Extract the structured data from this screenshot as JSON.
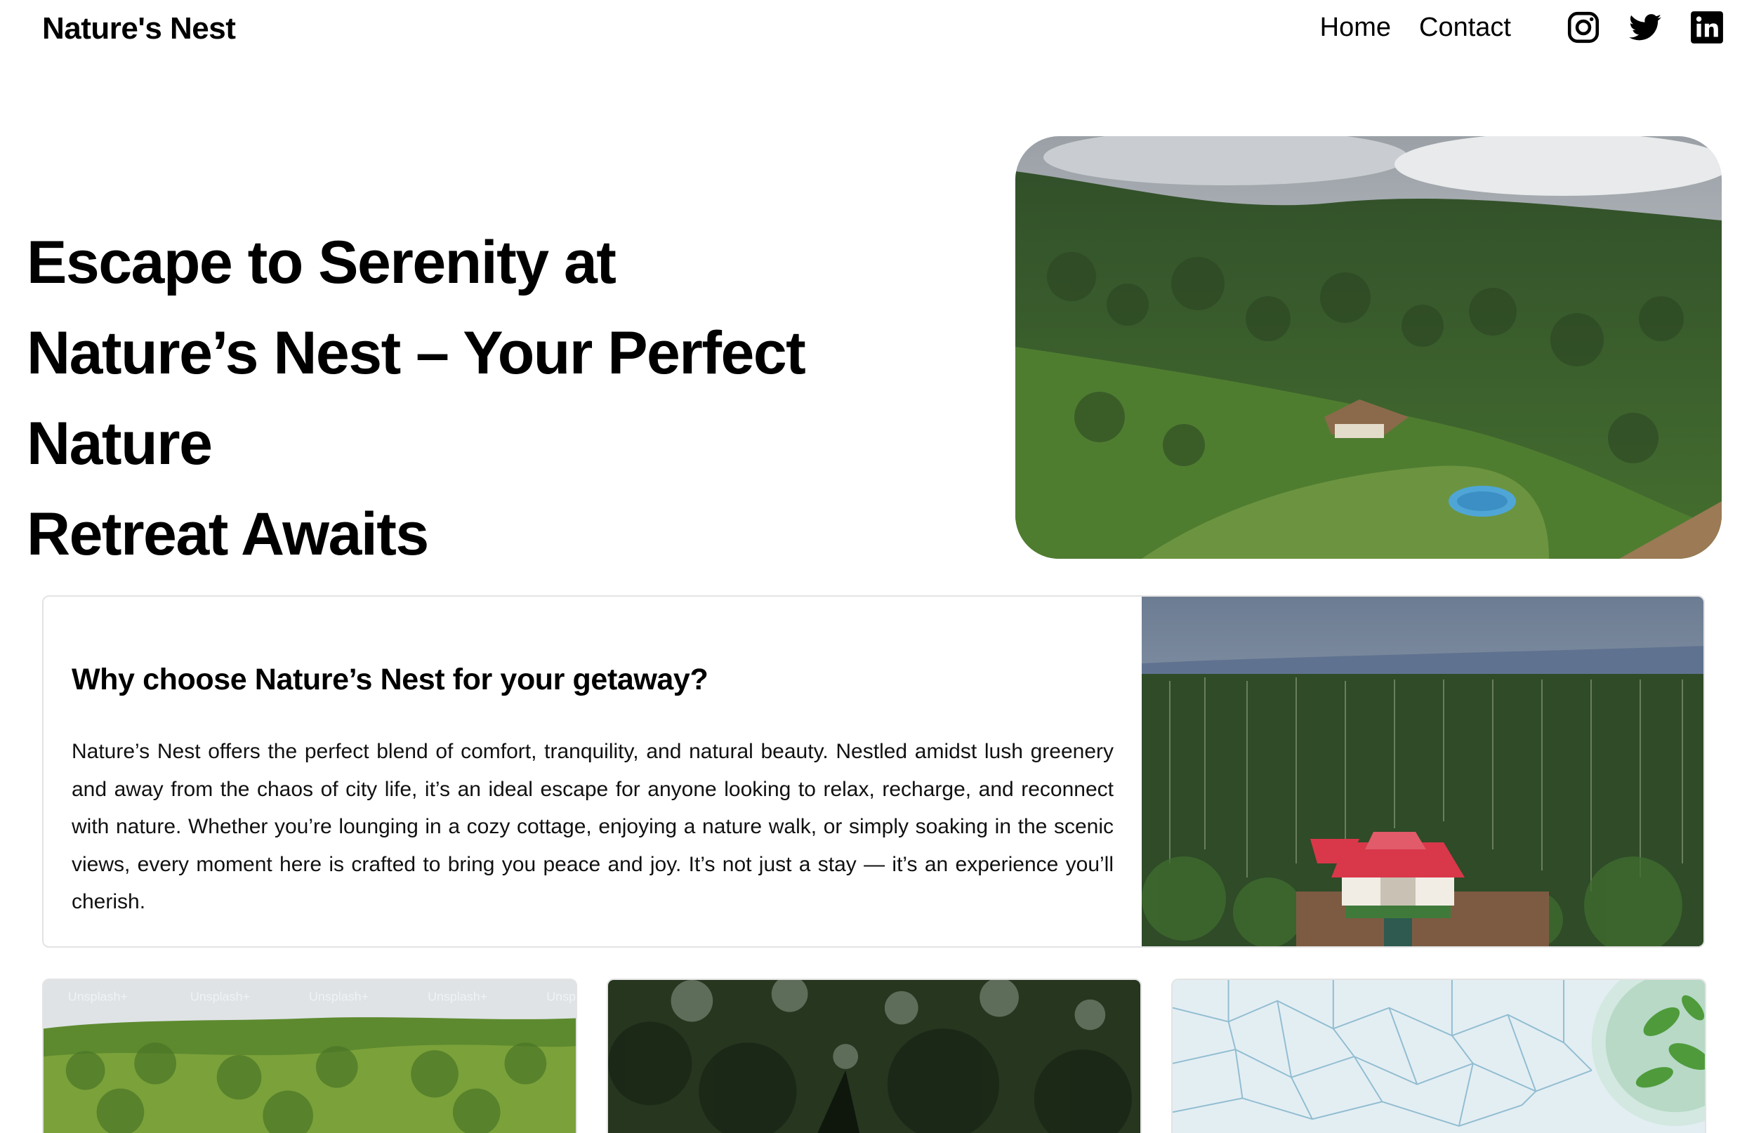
{
  "header": {
    "brand": "Nature's Nest",
    "nav": [
      {
        "label": "Home"
      },
      {
        "label": "Contact"
      }
    ],
    "social": [
      {
        "icon": "instagram-icon"
      },
      {
        "icon": "twitter-icon"
      },
      {
        "icon": "linkedin-icon"
      }
    ]
  },
  "hero": {
    "title_lines": [
      "Escape to Serenity at",
      "Nature’s Nest – Your Perfect Nature",
      "Retreat Awaits"
    ]
  },
  "card": {
    "title": "Why choose Nature’s Nest for your getaway?",
    "body": "Nature’s Nest offers the perfect blend of comfort, tranquility, and natural beauty. Nestled amidst lush greenery and away from the chaos of city life, it’s an ideal escape for anyone looking to relax, recharge, and reconnect with nature. Whether you’re lounging in a cozy cottage, enjoying a nature walk, or simply soaking in the scenic views, every moment here is crafted to bring you peace and joy. It’s not just a stay — it’s an experience you’ll cherish."
  },
  "gallery": {
    "watermark": "Unsplash+"
  },
  "colors": {
    "text": "#000000",
    "border": "#e3e3e3",
    "forest_dark": "#2f4a25",
    "forest_mid": "#4d7a34",
    "roof_red": "#d9374a",
    "sky": "#c9d0d8"
  }
}
